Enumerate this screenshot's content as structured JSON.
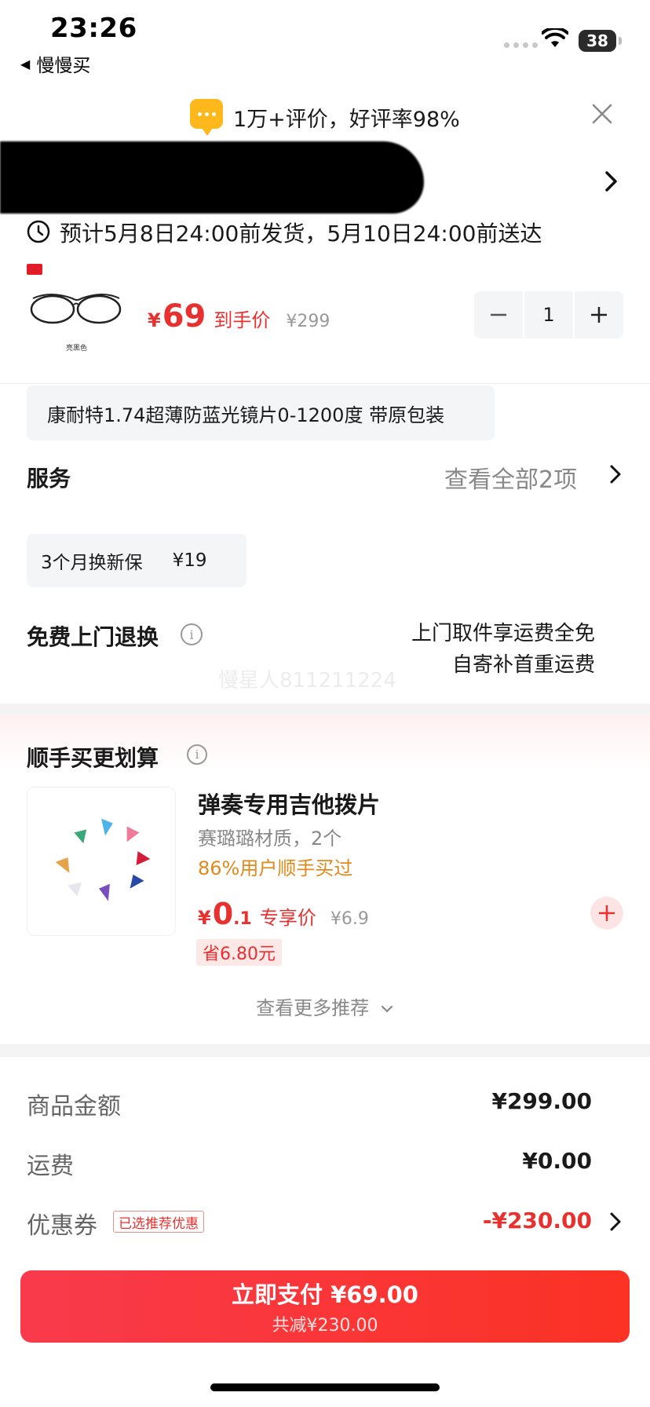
{
  "status_bar": {
    "time": "23:26",
    "back_app": "慢慢买",
    "battery": "38"
  },
  "rating_banner": {
    "text": "1万+评价，好评率98%"
  },
  "delivery": {
    "text": "预计5月8日24:00前发货，5月10日24:00前送达"
  },
  "product": {
    "color_label": "亮黑色",
    "currency": "¥",
    "price_value": "69",
    "price_tag": "到手价",
    "original_price": "¥299",
    "quantity": "1",
    "spec": "康耐特1.74超薄防蓝光镜片0-1200度 带原包装"
  },
  "service": {
    "title": "服务",
    "view_all": "查看全部2项",
    "chip_name": "3个月换新保",
    "chip_price": "¥19"
  },
  "free_return": {
    "title": "免费上门退换",
    "line1": "上门取件享运费全免",
    "line2": "自寄补首重运费",
    "watermark": "慢星人811211224"
  },
  "upsell": {
    "title": "顺手买更划算",
    "name": "弹奏专用吉他拨片",
    "desc": "赛璐璐材质，2个",
    "stat": "86%用户顺手买过",
    "currency": "¥",
    "price_int": "0",
    "price_dec": ".1",
    "price_tag": "专享价",
    "original_price": "¥6.9",
    "save": "省6.80元",
    "more": "查看更多推荐"
  },
  "totals": {
    "goods_label": "商品金额",
    "goods_value": "¥299.00",
    "shipping_label": "运费",
    "shipping_value": "¥0.00",
    "coupon_label": "优惠券",
    "coupon_tag": "已选推荐优惠",
    "coupon_value": "-¥230.00"
  },
  "pay": {
    "main": "立即支付 ¥69.00",
    "sub": "共减¥230.00"
  },
  "colors": {
    "accent": "#e8302f",
    "pay_button": "#f83a4c",
    "rating_icon": "#ffb81c",
    "upsell_stat": "#e08a1e"
  },
  "icons": [
    "back-triangle-icon",
    "wifi-icon",
    "chat-bubble-icon",
    "close-icon",
    "chevron-right-icon",
    "clock-icon",
    "minus-icon",
    "plus-icon",
    "info-icon",
    "chevron-down-icon"
  ]
}
